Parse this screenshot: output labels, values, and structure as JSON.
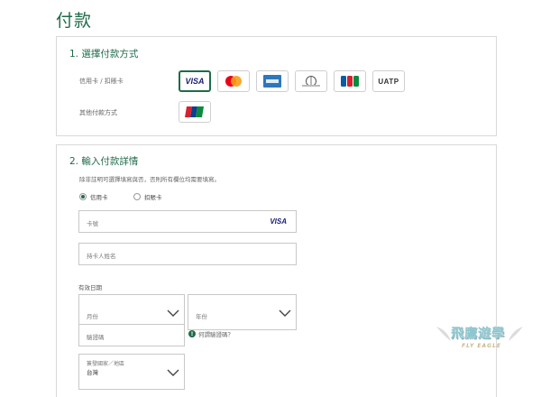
{
  "page": {
    "title": "付款"
  },
  "section1": {
    "title": "1. 選擇付款方式",
    "row_credit_label": "信用卡 / 扣賬卡",
    "row_other_label": "其他付款方式",
    "cards": [
      {
        "name": "VISA",
        "icon": "visa-logo",
        "selected": true
      },
      {
        "name": "Mastercard",
        "icon": "mastercard-logo",
        "selected": false
      },
      {
        "name": "American Express",
        "icon": "amex-logo",
        "selected": false
      },
      {
        "name": "Diners Club",
        "icon": "diners-club-logo",
        "selected": false
      },
      {
        "name": "JCB",
        "icon": "jcb-logo",
        "selected": false
      },
      {
        "name": "UATP",
        "icon": "uatp-logo",
        "selected": false
      }
    ],
    "other": [
      {
        "name": "UnionPay",
        "icon": "unionpay-logo"
      }
    ],
    "visa_text": "VISA",
    "uatp_text": "UATP"
  },
  "section2": {
    "title": "2. 輸入付款詳情",
    "note": "除非註明可選擇填寫與否，否則所有欄位均需要填寫。",
    "radio_credit": "信用卡",
    "radio_debit": "扣賬卡",
    "selected_radio": "信用卡",
    "card_number_placeholder": "卡號",
    "card_brand_text": "VISA",
    "cardholder_placeholder": "持卡人姓名",
    "expiry_label": "有效日期",
    "month_placeholder": "月份",
    "year_placeholder": "年份",
    "cvv_placeholder": "驗證碼",
    "cvv_hint": "何謂驗證碼？",
    "country_label": "簽發國家／地區",
    "country_value": "台灣"
  },
  "watermark": {
    "title": "飛鷹遊學",
    "subtitle": "FLY EAGLE"
  },
  "colors": {
    "accent": "#1f6b4a",
    "border": "#d9d9d9",
    "visa_blue": "#1a1f71",
    "mc_red": "#eb001b",
    "mc_orange": "#f79e1b",
    "amex_blue": "#2e77bc"
  }
}
